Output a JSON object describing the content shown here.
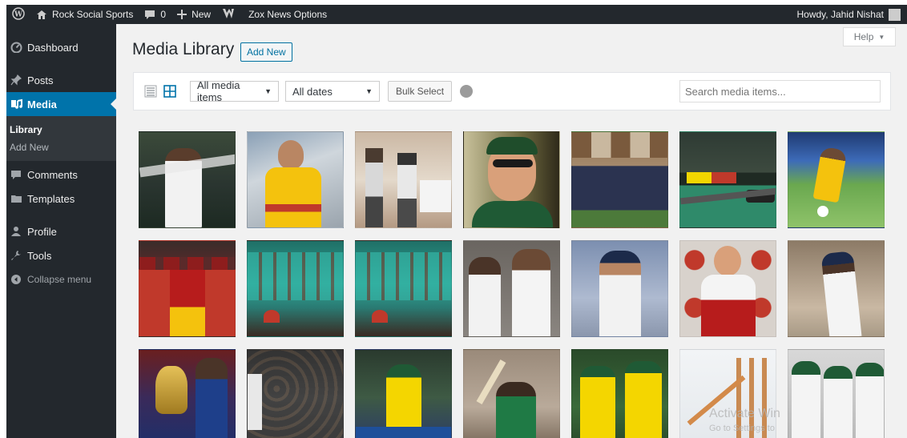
{
  "adminbar": {
    "site_name": "Rock Social Sports",
    "comments_count": "0",
    "new_label": "New",
    "plugin_label": "Zox News Options",
    "howdy": "Howdy, Jahid Nishat"
  },
  "sidebar": {
    "dashboard": "Dashboard",
    "posts": "Posts",
    "media": "Media",
    "library": "Library",
    "add_new": "Add New",
    "comments": "Comments",
    "templates": "Templates",
    "profile": "Profile",
    "tools": "Tools",
    "collapse": "Collapse menu"
  },
  "header": {
    "title": "Media Library",
    "add_new": "Add New",
    "help": "Help"
  },
  "toolbar": {
    "filter_type": "All media items",
    "filter_date": "All dates",
    "bulk_select": "Bulk Select",
    "search_placeholder": "Search media items..."
  },
  "watermark": {
    "line1": "Activate Win",
    "line2": "Go to Settings to"
  },
  "colors": {
    "adminbar": "#23282d",
    "accent": "#0073aa"
  },
  "media_items": [
    {
      "name": "football-psg-player"
    },
    {
      "name": "football-barcelona-player"
    },
    {
      "name": "official-meeting"
    },
    {
      "name": "cricket-coach-portrait"
    },
    {
      "name": "team-group-outdoor"
    },
    {
      "name": "formula-one-car"
    },
    {
      "name": "football-barcelona-action"
    },
    {
      "name": "cricket-zimbabwe-team"
    },
    {
      "name": "cricket-team-celebration-1"
    },
    {
      "name": "cricket-team-celebration-2"
    },
    {
      "name": "cricket-india-players"
    },
    {
      "name": "cricket-india-jadeja"
    },
    {
      "name": "racing-driver-portrait"
    },
    {
      "name": "cricket-india-bowler"
    },
    {
      "name": "cricket-trophy-team"
    },
    {
      "name": "cricket-crowd"
    },
    {
      "name": "cricket-australia-batsman"
    },
    {
      "name": "cricket-south-africa-batsman"
    },
    {
      "name": "cricket-australia-team"
    },
    {
      "name": "cricket-stumps"
    },
    {
      "name": "cricket-bangladesh-team"
    }
  ]
}
